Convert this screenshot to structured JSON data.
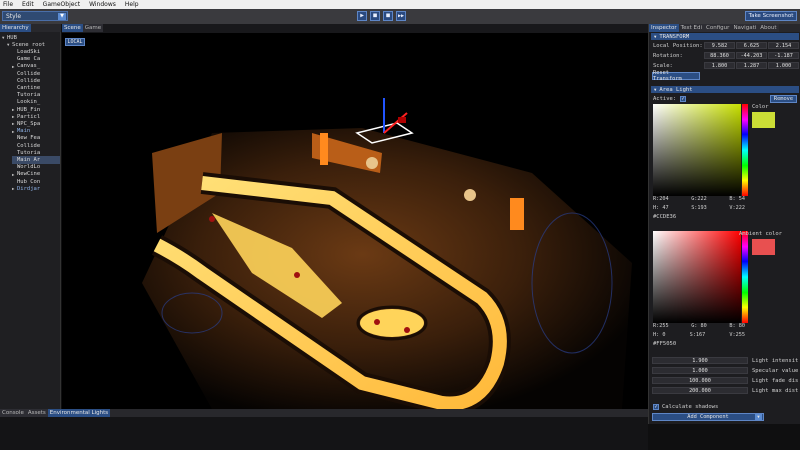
{
  "menu": [
    "File",
    "Edit",
    "GameObject",
    "Windows",
    "Help"
  ],
  "toolbar": {
    "style_select": "Style",
    "play_controls": [
      {
        "name": "play-button",
        "glyph": "▶"
      },
      {
        "name": "pause-button",
        "glyph": "■"
      },
      {
        "name": "stop-button",
        "glyph": "■"
      },
      {
        "name": "step-button",
        "glyph": "▶▶"
      }
    ],
    "screenshot_label": "Take Screenshot"
  },
  "hierarchy": {
    "tab": "Hierarchy",
    "items": [
      {
        "label": "HUB",
        "indent": 0,
        "tri": "▼"
      },
      {
        "label": "Scene root",
        "indent": 1,
        "tri": "▼"
      },
      {
        "label": "LoadSki",
        "indent": 2,
        "tri": ""
      },
      {
        "label": "Game Ca",
        "indent": 2,
        "tri": ""
      },
      {
        "label": "Canvas_",
        "indent": 2,
        "tri": "▶"
      },
      {
        "label": "Collide",
        "indent": 2,
        "tri": ""
      },
      {
        "label": "Collide",
        "indent": 2,
        "tri": ""
      },
      {
        "label": "Cantine",
        "indent": 2,
        "tri": ""
      },
      {
        "label": "Tutoria",
        "indent": 2,
        "tri": "",
        "style": "dim"
      },
      {
        "label": "Lookin_",
        "indent": 2,
        "tri": ""
      },
      {
        "label": "HUB_Fin",
        "indent": 2,
        "tri": "▶"
      },
      {
        "label": "Particl",
        "indent": 2,
        "tri": "▶"
      },
      {
        "label": "NPC_Spa",
        "indent": 2,
        "tri": "▶"
      },
      {
        "label": "Main",
        "indent": 2,
        "tri": "▶",
        "style": "hl"
      },
      {
        "label": "New Fea",
        "indent": 2,
        "tri": ""
      },
      {
        "label": "Collide",
        "indent": 2,
        "tri": ""
      },
      {
        "label": "Tutoria",
        "indent": 2,
        "tri": ""
      },
      {
        "label": "Main Ar",
        "indent": 2,
        "tri": "",
        "style": "sel"
      },
      {
        "label": "WorldLo",
        "indent": 2,
        "tri": ""
      },
      {
        "label": "NewCine",
        "indent": 2,
        "tri": "▶"
      },
      {
        "label": "Hub Con",
        "indent": 2,
        "tri": ""
      },
      {
        "label": "Dirdjar",
        "indent": 2,
        "tri": "▶",
        "style": "hl"
      }
    ]
  },
  "scene": {
    "tabs": [
      "Scene",
      "Game"
    ],
    "local_label": "LOCAL"
  },
  "inspector": {
    "tabs": [
      "Inspector",
      "Text Edi",
      "Configur",
      "Navigati",
      "About"
    ],
    "transform": {
      "header": "TRANSFORM",
      "rows": [
        {
          "label": "Local Position:",
          "values": [
            "9.582",
            "6.625",
            "2.154"
          ]
        },
        {
          "label": "Rotation:",
          "values": [
            "88.360",
            "-44.203",
            "-1.187"
          ]
        },
        {
          "label": "Scale:",
          "values": [
            "1.800",
            "1.287",
            "1.000"
          ]
        }
      ],
      "reset_label": "Reset Transform"
    },
    "light": {
      "header": "Area Light",
      "active_label": "Active:",
      "active_check": "✓",
      "remove_label": "Remove",
      "color_label": "Color",
      "color": {
        "r": "R:204",
        "g": "G:222",
        "b": "B: 54",
        "h": "H: 47",
        "s": "S:193",
        "v": "V:222",
        "hex": "#CCDE36",
        "swatch": "#ccde36"
      },
      "ambient_label": "Ambient color",
      "ambient": {
        "r": "R:255",
        "g": "G: 80",
        "b": "B: 80",
        "h": "H:  0",
        "s": "S:167",
        "v": "V:255",
        "hex": "#FF5050",
        "swatch": "#e85050"
      },
      "fields": [
        {
          "value": "1.900",
          "label": "Light intensit"
        },
        {
          "value": "1.000",
          "label": "Specular value"
        },
        {
          "value": "100.000",
          "label": "Light fade dis"
        },
        {
          "value": "200.000",
          "label": "Light max dist"
        }
      ],
      "shadows_check": "✓",
      "shadows_label": "Calculate shadows"
    },
    "add_component": "Add Component"
  },
  "bottom": {
    "tabs": [
      "Console",
      "Assets",
      "Environmental Lights"
    ]
  }
}
